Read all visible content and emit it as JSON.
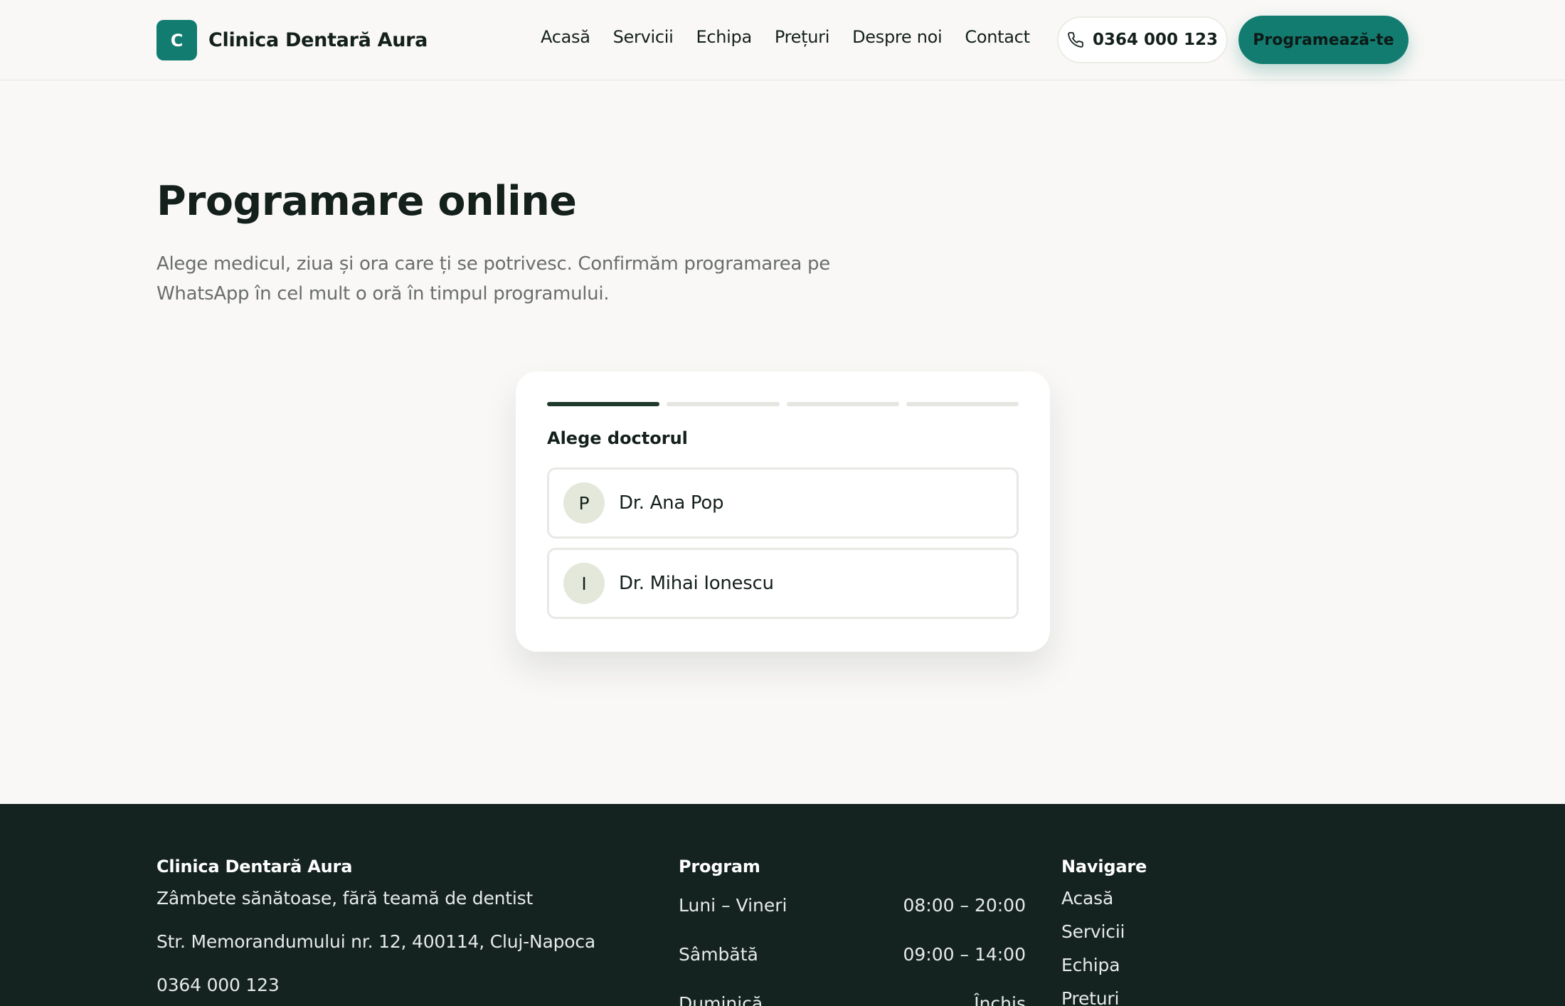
{
  "header": {
    "logo_letter": "C",
    "brand": "Clinica Dentară Aura",
    "nav": [
      "Acasă",
      "Servicii",
      "Echipa",
      "Prețuri",
      "Despre noi",
      "Contact"
    ],
    "phone": "0364 000 123",
    "cta": "Programează-te"
  },
  "hero": {
    "title": "Programare online",
    "subtitle": "Alege medicul, ziua și ora care ți se potrivesc. Confirmăm programarea pe WhatsApp în cel mult o oră în timpul programului."
  },
  "booking": {
    "steps_total": 4,
    "current_step": 1,
    "title": "Alege doctorul",
    "doctors": [
      {
        "initial": "P",
        "name": "Dr. Ana Pop"
      },
      {
        "initial": "I",
        "name": "Dr. Mihai Ionescu"
      }
    ]
  },
  "footer": {
    "brand": "Clinica Dentară Aura",
    "tagline": "Zâmbete sănătoase, fără teamă de dentist",
    "address": "Str. Memorandumului nr. 12, 400114, Cluj-Napoca",
    "phone": "0364 000 123",
    "program_heading": "Program",
    "program": [
      {
        "day": "Luni – Vineri",
        "hours": "08:00 – 20:00"
      },
      {
        "day": "Sâmbătă",
        "hours": "09:00 – 14:00"
      },
      {
        "day": "Duminică",
        "hours": "Închis"
      }
    ],
    "nav_heading": "Navigare",
    "nav": [
      "Acasă",
      "Servicii",
      "Echipa",
      "Prețuri"
    ]
  },
  "colors": {
    "accent": "#137c70",
    "dark": "#142320",
    "background": "#f9f8f6",
    "progress_active": "#1d3a2c"
  },
  "icons": {
    "phone": "phone-icon"
  }
}
